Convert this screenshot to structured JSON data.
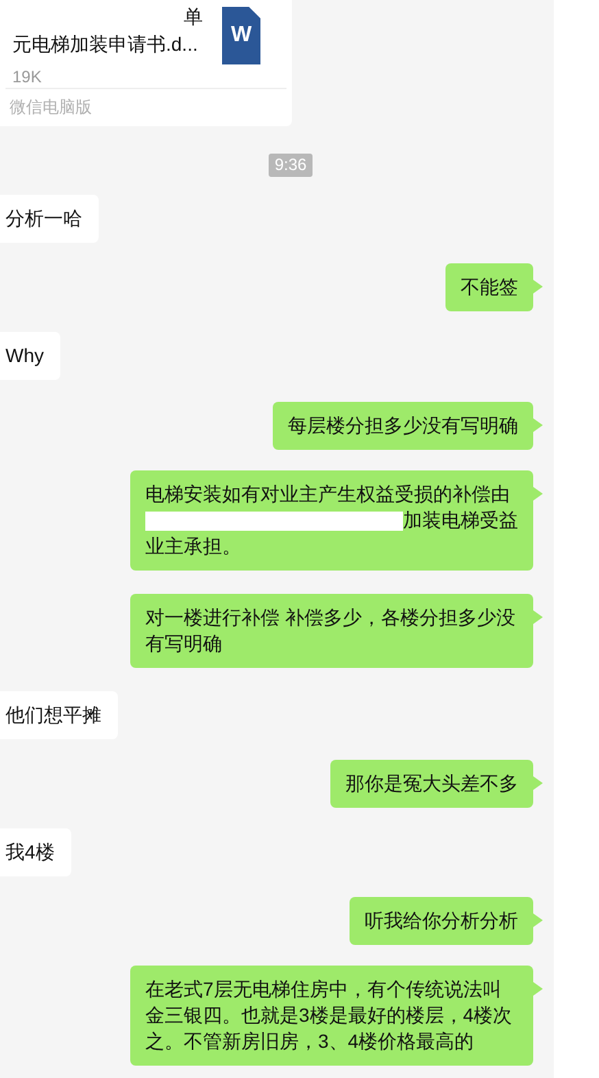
{
  "file_card": {
    "name_lines": [
      "单",
      "元电梯加装申请书.d..."
    ],
    "size": "19K",
    "source": "微信电脑版",
    "icon_letter": "W"
  },
  "messages": [
    {
      "kind": "time",
      "text": "9:36"
    },
    {
      "kind": "received",
      "text": "分析一哈"
    },
    {
      "kind": "sent",
      "text": "不能签"
    },
    {
      "kind": "received",
      "text": "Why"
    },
    {
      "kind": "sent",
      "text": "每层楼分担多少没有写明确"
    },
    {
      "kind": "sent",
      "text": "电梯安装如有对业主产生权益受损的补偿由",
      "redacted": true,
      "text_after": "加装电梯受益业主承担。"
    },
    {
      "kind": "sent",
      "text": "对一楼进行补偿  补偿多少，各楼分担多少没有写明确"
    },
    {
      "kind": "received",
      "text": "他们想平摊"
    },
    {
      "kind": "sent",
      "text": "那你是冤大头差不多"
    },
    {
      "kind": "received",
      "text": "我4楼"
    },
    {
      "kind": "sent",
      "text": "听我给你分析分析"
    },
    {
      "kind": "sent",
      "text": "在老式7层无电梯住房中，有个传统说法叫金三银四。也就是3楼是最好的楼层，4楼次之。不管新房旧房，3、4楼价格最高的"
    }
  ]
}
